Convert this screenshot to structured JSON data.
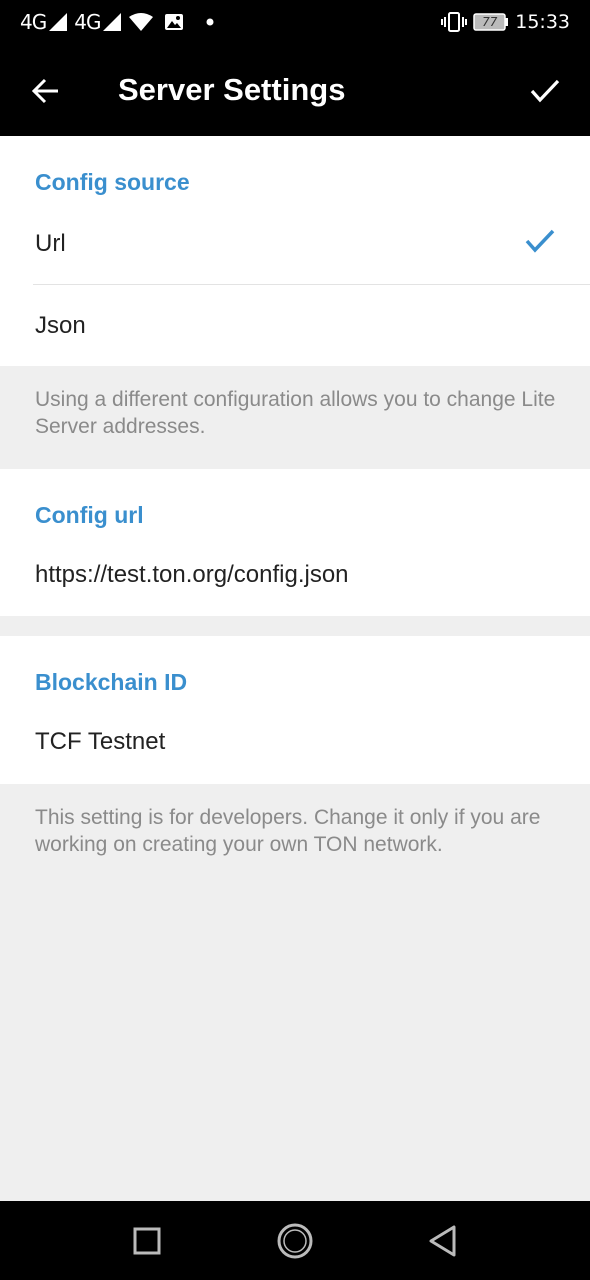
{
  "status_bar": {
    "network1": "4G",
    "network2": "4G",
    "battery": "77",
    "time": "15:33"
  },
  "app_bar": {
    "title": "Server Settings"
  },
  "config_source": {
    "header": "Config source",
    "options": [
      "Url",
      "Json"
    ],
    "selected": "Url"
  },
  "config_source_info": "Using a different configuration allows you to change Lite Server addresses.",
  "config_url": {
    "header": "Config url",
    "value": "https://test.ton.org/config.json"
  },
  "blockchain": {
    "header": "Blockchain ID",
    "value": "TCF Testnet"
  },
  "blockchain_info": "This setting is for developers. Change it only if you are working on creating your own TON network.",
  "colors": {
    "accent": "#3a8fce",
    "bar": "#000000",
    "background": "#efefef"
  },
  "icons": [
    "back-arrow-icon",
    "checkmark-icon",
    "square-icon",
    "circle-icon",
    "triangle-back-icon"
  ]
}
